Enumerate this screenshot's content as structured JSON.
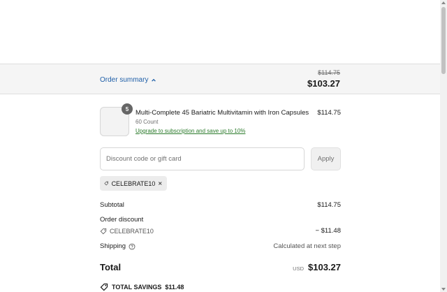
{
  "summary": {
    "toggle_label": "Order summary",
    "original_total": "$114.75",
    "current_total": "$103.27"
  },
  "line_item": {
    "quantity": "5",
    "name": "Multi-Complete 45 Bariatric Multivitamin with Iron Capsules",
    "variant": "60 Count",
    "upgrade_link": "Upgrade to subscription and save up to 10%",
    "price": "$114.75"
  },
  "discount": {
    "placeholder": "Discount code or gift card",
    "apply_label": "Apply",
    "applied_code": "CELEBRATE10"
  },
  "totals": {
    "subtotal_label": "Subtotal",
    "subtotal_value": "$114.75",
    "order_discount_label": "Order discount",
    "discount_code": "CELEBRATE10",
    "discount_value": "− $11.48",
    "shipping_label": "Shipping",
    "shipping_value": "Calculated at next step",
    "total_label": "Total",
    "currency": "USD",
    "total_value": "$103.27",
    "savings_label": "TOTAL SAVINGS",
    "savings_value": "$11.48"
  },
  "icons": {
    "chevron": "chevron-up-icon",
    "tag": "tag-icon",
    "close": "close-icon",
    "help": "question-circle-icon"
  }
}
